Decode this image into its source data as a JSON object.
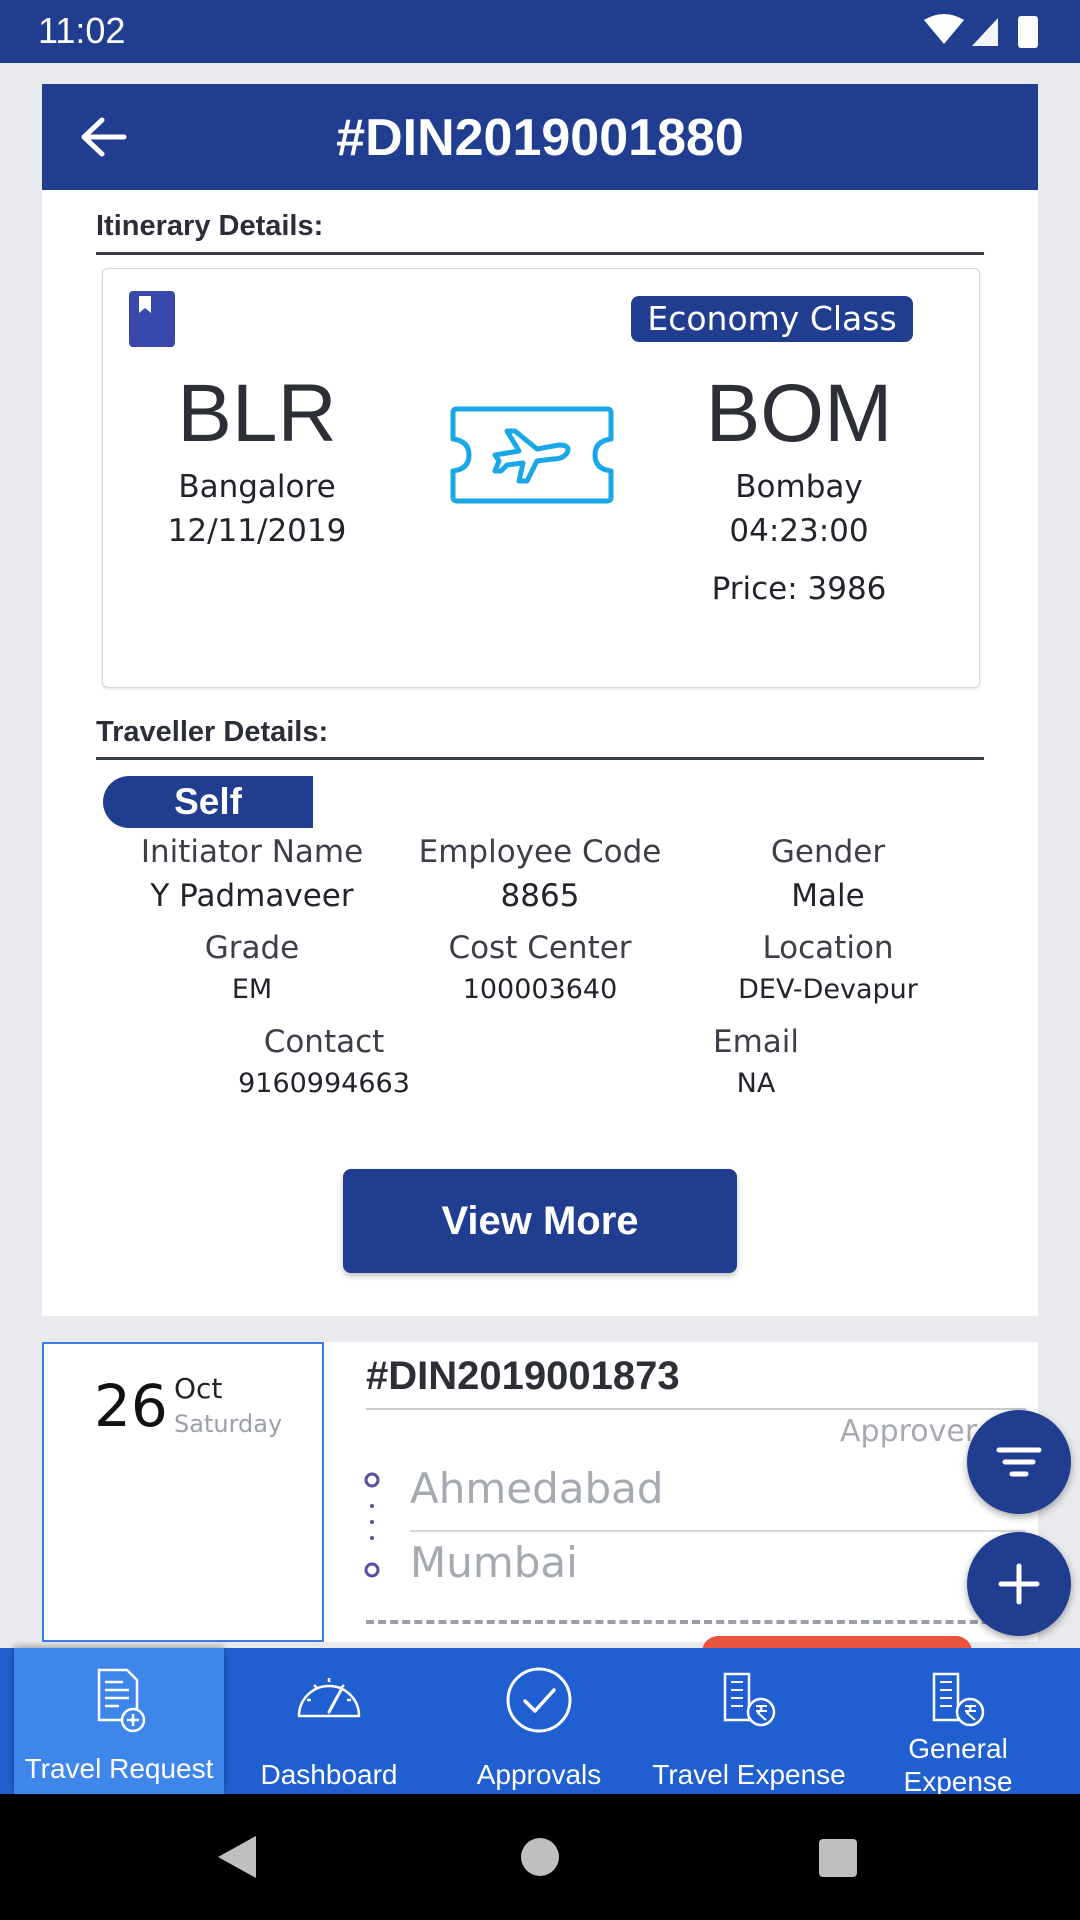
{
  "status_bar": {
    "time": "11:02"
  },
  "header": {
    "title": "#DIN2019001880"
  },
  "itinerary": {
    "section_label": "Itinerary Details:",
    "class_badge": "Economy Class",
    "from_code": "BLR",
    "from_city": "Bangalore",
    "from_date": "12/11/2019",
    "to_code": "BOM",
    "to_city": "Bombay",
    "to_time": "04:23:00",
    "price": "Price: 3986"
  },
  "traveller": {
    "section_label": "Traveller Details:",
    "tag": "Self",
    "initiator_label": "Initiator Name",
    "initiator_value": "Y Padmaveer",
    "employee_code_label": "Employee Code",
    "employee_code_value": "8865",
    "gender_label": "Gender",
    "gender_value": "Male",
    "grade_label": "Grade",
    "grade_value": "EM",
    "cost_center_label": "Cost Center",
    "cost_center_value": "100003640",
    "location_label": "Location",
    "location_value": "DEV-Devapur",
    "contact_label": "Contact",
    "contact_value": "9160994663",
    "email_label": "Email",
    "email_value": "NA"
  },
  "view_more_label": "View More",
  "request_card": {
    "day": "26",
    "month": "Oct",
    "weekday": "Saturday",
    "id": "#DIN2019001873",
    "approver": "Approver 1",
    "from_city": "Ahmedabad",
    "to_city": "Mumbai"
  },
  "bottom_nav": {
    "items": [
      {
        "label": "Travel Request",
        "icon": "document-add-icon"
      },
      {
        "label": "Dashboard",
        "icon": "speedometer-icon"
      },
      {
        "label": "Approvals",
        "icon": "check-circle-icon"
      },
      {
        "label": "Travel Expense",
        "icon": "building-rupee-icon"
      },
      {
        "label": "General Expense",
        "icon": "building-rupee-icon"
      }
    ]
  },
  "colors": {
    "primary": "#203d8f",
    "nav_bg": "#1f5fcf",
    "nav_active": "#3f86ea",
    "ticket_cyan": "#1aa7e8",
    "accent_red": "#e8543e"
  }
}
